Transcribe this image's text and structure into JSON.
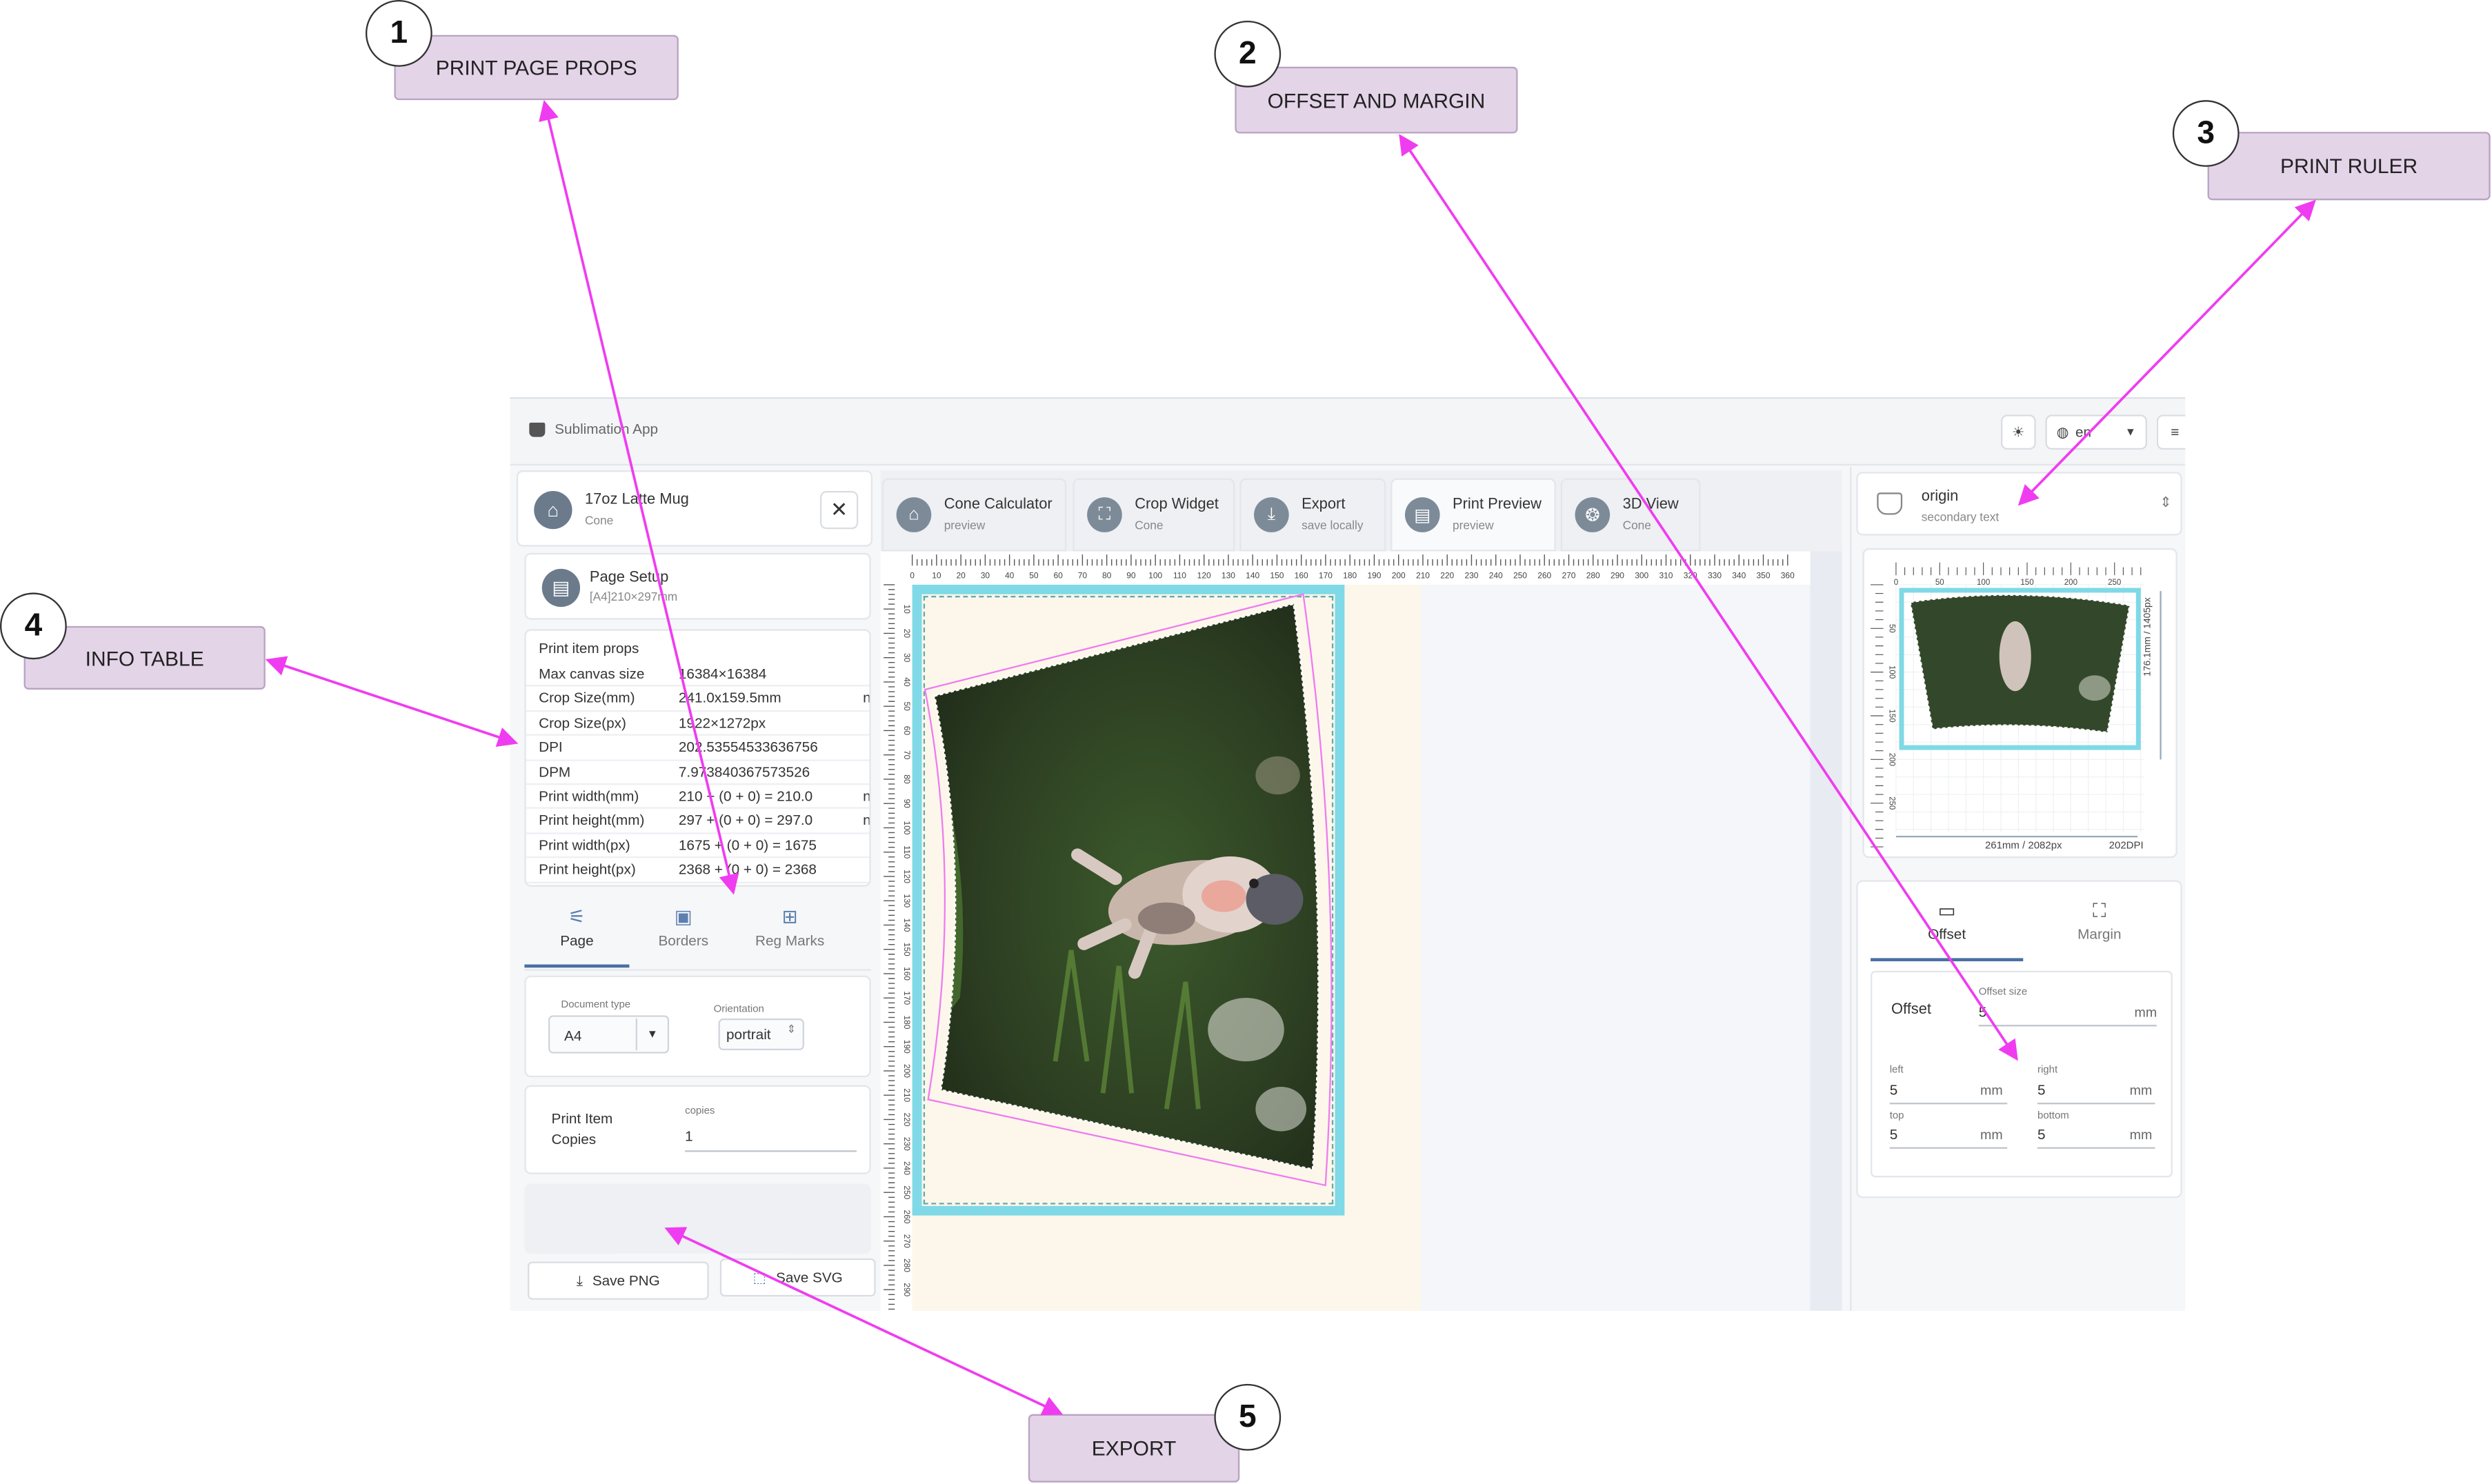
{
  "callouts": [
    {
      "num": "1",
      "label": "PRINT PAGE PROPS"
    },
    {
      "num": "2",
      "label": "OFFSET AND MARGIN"
    },
    {
      "num": "3",
      "label": "PRINT RULER"
    },
    {
      "num": "4",
      "label": "INFO TABLE"
    },
    {
      "num": "5",
      "label": "EXPORT"
    }
  ],
  "app": {
    "title": "Sublimation App",
    "lang": "en"
  },
  "product": {
    "name": "17oz Latte Mug",
    "shape": "Cone"
  },
  "page_setup": {
    "label": "Page Setup",
    "sub": "[A4]210×297mm"
  },
  "info_table": {
    "title": "Print item props",
    "rows": [
      {
        "k": "Max canvas size",
        "v": "16384×16384",
        "n": ""
      },
      {
        "k": "Crop Size(mm)",
        "v": "241.0x159.5mm",
        "n": "n"
      },
      {
        "k": "Crop Size(px)",
        "v": "1922×1272px",
        "n": ""
      },
      {
        "k": "DPI",
        "v": "202.53554533636756",
        "n": ""
      },
      {
        "k": "DPM",
        "v": "7.973840367573526",
        "n": ""
      },
      {
        "k": "Print width(mm)",
        "v": "210 + (0 + 0) = 210.0",
        "n": "n"
      },
      {
        "k": "Print height(mm)",
        "v": "297 + (0 + 0) = 297.0",
        "n": "n"
      },
      {
        "k": "Print width(px)",
        "v": "1675 + (0 + 0) = 1675",
        "n": ""
      },
      {
        "k": "Print height(px)",
        "v": "2368 + (0 + 0) = 2368",
        "n": ""
      }
    ]
  },
  "left_tabs": [
    {
      "label": "Page",
      "icon": "sliders-icon"
    },
    {
      "label": "Borders",
      "icon": "frame-icon"
    },
    {
      "label": "Reg Marks",
      "icon": "reg-marks-icon"
    }
  ],
  "page_form": {
    "doc_type_label": "Document type",
    "doc_type_value": "A4",
    "orientation_label": "Orientation",
    "orientation_value": "portrait"
  },
  "copies": {
    "label1": "Print Item",
    "label2": "Copies",
    "field_label": "copies",
    "value": "1"
  },
  "export": {
    "png": "Save PNG",
    "svg": "Save SVG"
  },
  "center_tabs": [
    {
      "l1": "Cone Calculator",
      "l2": "preview"
    },
    {
      "l1": "Crop Widget",
      "l2": "Cone"
    },
    {
      "l1": "Export",
      "l2": "save locally"
    },
    {
      "l1": "Print Preview",
      "l2": "preview"
    },
    {
      "l1": "3D View",
      "l2": "Cone"
    }
  ],
  "ruler": {
    "h_ticks": [
      "0",
      "10",
      "20",
      "30",
      "40",
      "50",
      "60",
      "70",
      "80",
      "90",
      "100",
      "110",
      "120",
      "130",
      "140",
      "150",
      "160",
      "170",
      "180",
      "190",
      "200",
      "210",
      "220",
      "230",
      "240",
      "250",
      "260",
      "270",
      "280",
      "290",
      "300",
      "310",
      "320",
      "330",
      "340",
      "350",
      "360"
    ],
    "v_ticks": [
      "10",
      "20",
      "30",
      "40",
      "50",
      "60",
      "70",
      "80",
      "90",
      "100",
      "110",
      "120",
      "130",
      "140",
      "150",
      "160",
      "170",
      "180",
      "190",
      "200",
      "210",
      "220",
      "230",
      "240",
      "250",
      "260",
      "270",
      "280",
      "290"
    ]
  },
  "right": {
    "origin_title": "origin",
    "origin_sub": "secondary text",
    "mini_h_ticks": [
      "0",
      "50",
      "100",
      "150",
      "200",
      "250"
    ],
    "mini_v_ticks": [
      "50",
      "100",
      "150",
      "200",
      "250"
    ],
    "height_label": "176.1mm / 1405px",
    "width_label": "261mm / 2082px",
    "dpi_label": "202DPI",
    "tabs": [
      {
        "label": "Offset",
        "icon": "offset-icon"
      },
      {
        "label": "Margin",
        "icon": "margin-icon"
      }
    ],
    "offset_label": "Offset",
    "offset_size_label": "Offset size",
    "offset_size_value": "5",
    "unit": "mm",
    "left_label": "left",
    "left_value": "5",
    "right_label": "right",
    "right_value": "5",
    "top_label": "top",
    "top_value": "5",
    "bottom_label": "bottom",
    "bottom_value": "5"
  },
  "colors": {
    "accent": "#4a6fa5",
    "arrow": "#f03cf0",
    "cyan_border": "#7fd9e6",
    "callout_bg": "#e3d4e8"
  }
}
